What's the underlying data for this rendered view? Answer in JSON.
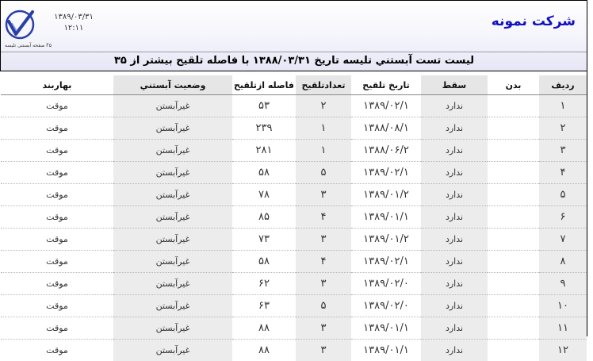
{
  "header": {
    "company": "شرکت نمونه",
    "date": "۱۳۸۹/۰۳/۳۱",
    "time": "۱۲:۱۱",
    "report_code": "ﺻﻔﺤﻪ آﺑﺴﺘﻨﯽ ﺗﻠﯿﺴﻪ F۵",
    "subtitle": "لیست تست آبستني تلیسه  تاریخ ۱۳۸۸/۰۳/۳۱ با فاصله تلقیح بیشتر از ۳۵"
  },
  "columns": {
    "pregnancy_status": "بهاربند",
    "pregnancy_state": "وضعیت آبستني",
    "interval": "فاصله ازتلقیح",
    "count": "تعدادتلقیح",
    "insem_date": "تاریخ تلقیح",
    "abortion": "سقط",
    "body": "بدن",
    "row": "ردیف"
  },
  "rows": [
    {
      "pen": "موقت",
      "state": "غیرآبستن",
      "interval": "۵۳",
      "count": "۲",
      "date": "۱۳۸۹/۰۲/۱",
      "abortion": "ندارد",
      "body": "",
      "row": "۱"
    },
    {
      "pen": "موقت",
      "state": "غیرآبستن",
      "interval": "۲۳۹",
      "count": "۱",
      "date": "۱۳۸۸/۰۸/۱",
      "abortion": "ندارد",
      "body": "",
      "row": "۲"
    },
    {
      "pen": "موقت",
      "state": "غیرآبستن",
      "interval": "۲۸۱",
      "count": "۱",
      "date": "۱۳۸۸/۰۶/۲",
      "abortion": "ندارد",
      "body": "",
      "row": "۳"
    },
    {
      "pen": "موقت",
      "state": "غیرآبستن",
      "interval": "۵۸",
      "count": "۵",
      "date": "۱۳۸۹/۰۲/۱",
      "abortion": "ندارد",
      "body": "",
      "row": "۴"
    },
    {
      "pen": "موقت",
      "state": "غیرآبستن",
      "interval": "۷۸",
      "count": "۳",
      "date": "۱۳۸۹/۰۱/۲",
      "abortion": "ندارد",
      "body": "",
      "row": "۵"
    },
    {
      "pen": "موقت",
      "state": "غیرآبستن",
      "interval": "۸۵",
      "count": "۴",
      "date": "۱۳۸۹/۰۱/۱",
      "abortion": "ندارد",
      "body": "",
      "row": "۶"
    },
    {
      "pen": "موقت",
      "state": "غیرآبستن",
      "interval": "۷۳",
      "count": "۳",
      "date": "۱۳۸۹/۰۱/۲",
      "abortion": "ندارد",
      "body": "",
      "row": "۷"
    },
    {
      "pen": "موقت",
      "state": "غیرآبستن",
      "interval": "۵۸",
      "count": "۴",
      "date": "۱۳۸۹/۰۲/۱",
      "abortion": "ندارد",
      "body": "",
      "row": "۸"
    },
    {
      "pen": "موقت",
      "state": "غیرآبستن",
      "interval": "۶۲",
      "count": "۳",
      "date": "۱۳۸۹/۰۲/۰",
      "abortion": "ندارد",
      "body": "",
      "row": "۹"
    },
    {
      "pen": "موقت",
      "state": "غیرآبستن",
      "interval": "۶۳",
      "count": "۵",
      "date": "۱۳۸۹/۰۲/۰",
      "abortion": "ندارد",
      "body": "",
      "row": "۱۰"
    },
    {
      "pen": "موقت",
      "state": "غیرآبستن",
      "interval": "۸۸",
      "count": "۳",
      "date": "۱۳۸۹/۰۱/۱",
      "abortion": "ندارد",
      "body": "",
      "row": "۱۱"
    },
    {
      "pen": "موقت",
      "state": "غیرآبستن",
      "interval": "۸۸",
      "count": "۳",
      "date": "۱۳۸۹/۰۱/۱",
      "abortion": "ندارد",
      "body": "",
      "row": "۱۲"
    }
  ]
}
